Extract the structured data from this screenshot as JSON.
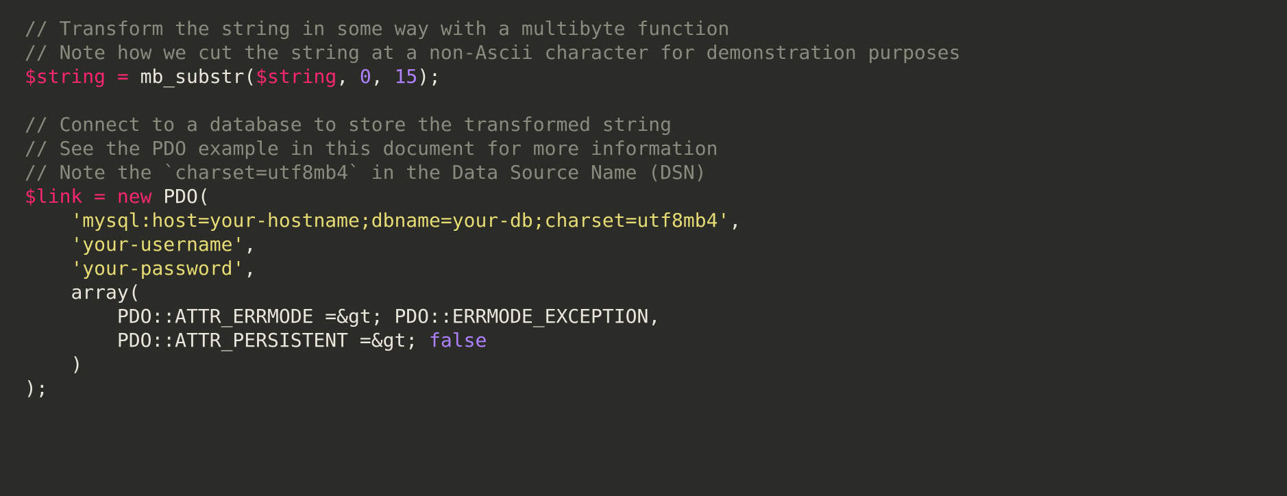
{
  "code": {
    "c1": "// Transform the string in some way with a multibyte function",
    "c2": "// Note how we cut the string at a non-Ascii character for demonstration purposes",
    "l3": {
      "var": "$string",
      "eq": " = ",
      "fn": "mb_substr",
      "open": "(",
      "arg1": "$string",
      "comma1": ", ",
      "num0": "0",
      "comma2": ", ",
      "num15": "15",
      "close": ");"
    },
    "c5": "// Connect to a database to store the transformed string",
    "c6": "// See the PDO example in this document for more information",
    "c7": "// Note the `charset=utf8mb4` in the Data Source Name (DSN)",
    "l8": {
      "var": "$link",
      "eq": " = ",
      "new": "new",
      "sp": " ",
      "class": "PDO",
      "open": "("
    },
    "l9": {
      "indent": "    ",
      "str": "'mysql:host=your-hostname;dbname=your-db;charset=utf8mb4'",
      "comma": ","
    },
    "l10": {
      "indent": "    ",
      "str": "'your-username'",
      "comma": ","
    },
    "l11": {
      "indent": "    ",
      "str": "'your-password'",
      "comma": ","
    },
    "l12": {
      "indent": "    ",
      "fn": "array",
      "open": "("
    },
    "l13": {
      "indent": "        ",
      "const1": "PDO::ATTR_ERRMODE",
      "arrow": " =&gt; ",
      "const2": "PDO::ERRMODE_EXCEPTION",
      "comma": ","
    },
    "l14": {
      "indent": "        ",
      "const1": "PDO::ATTR_PERSISTENT",
      "arrow": " =&gt; ",
      "val": "false"
    },
    "l15": {
      "indent": "    ",
      "close": ")"
    },
    "l16": {
      "close": ");"
    }
  }
}
